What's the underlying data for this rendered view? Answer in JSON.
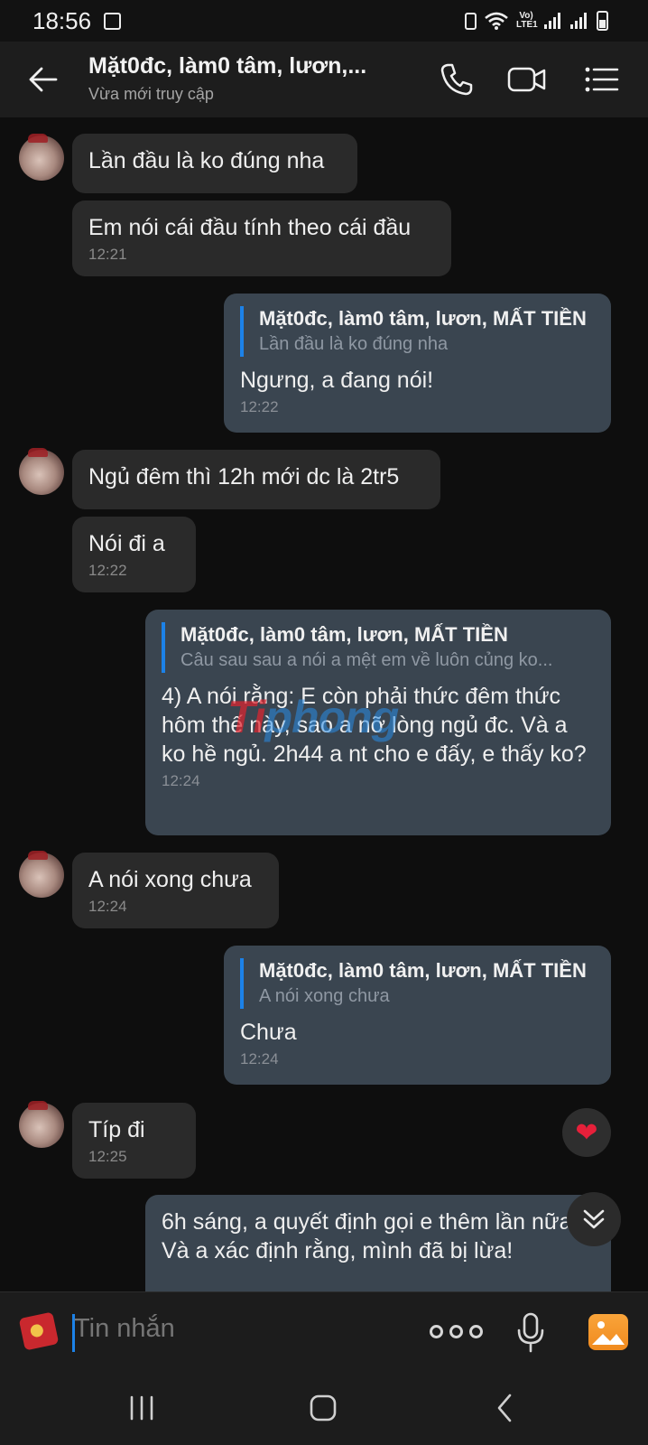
{
  "status_bar": {
    "time": "18:56",
    "network_label": "Vo) LTE1",
    "icons": [
      "image-icon",
      "nfc-icon",
      "wifi-icon",
      "signal-icon",
      "signal-icon",
      "battery-icon"
    ]
  },
  "header": {
    "contact_name": "Mặt0đc, làm0 tâm, lươn,...",
    "last_seen": "Vừa mới truy cập",
    "icons": [
      "back-arrow-icon",
      "phone-icon",
      "video-call-icon",
      "menu-list-icon"
    ]
  },
  "messages": [
    {
      "direction": "in",
      "text": "Lần đầu là ko đúng nha"
    },
    {
      "direction": "in",
      "text": "Em nói cái đầu tính theo cái đầu",
      "time": "12:21"
    },
    {
      "direction": "out",
      "quote_name": "Mặt0đc, làm0 tâm, lươn, MẤT TIỀN",
      "quote_text": "Lần đầu là ko đúng nha",
      "text": "Ngưng, a đang nói!",
      "time": "12:22"
    },
    {
      "direction": "in",
      "text": "Ngủ đêm thì 12h mới dc là 2tr5"
    },
    {
      "direction": "in",
      "text": "Nói đi a",
      "time": "12:22"
    },
    {
      "direction": "out",
      "quote_name": "Mặt0đc, làm0 tâm, lươn, MẤT TIỀN",
      "quote_text": "Câu sau sau a nói a mệt em về luôn củng ko...",
      "text": "4) A nói rằng: E còn phải thức đêm thức hôm thế này, sao a nỡ lòng ngủ đc. Và a ko hề ngủ. 2h44 a nt cho e đấy, e thấy ko?",
      "time": "12:24"
    },
    {
      "direction": "in",
      "text": "A nói xong chưa",
      "time": "12:24"
    },
    {
      "direction": "out",
      "quote_name": "Mặt0đc, làm0 tâm, lươn, MẤT TIỀN",
      "quote_text": "A nói xong chưa",
      "text": "Chưa",
      "time": "12:24"
    },
    {
      "direction": "in",
      "text": "Típ đi",
      "time": "12:25",
      "reaction": "❤"
    },
    {
      "direction": "out",
      "text": "6h sáng, a quyết định gọi e thêm lần nữa. Và a xác định rằng, mình đã bị lừa!"
    }
  ],
  "watermark": {
    "part1": "Ti",
    "part2": "phong"
  },
  "composer": {
    "placeholder": "Tin nhắn",
    "icons": [
      "sticker-icon",
      "more-options-icon",
      "microphone-icon",
      "image-gallery-icon"
    ]
  },
  "navbar": {
    "icons": [
      "recent-apps-icon",
      "home-icon",
      "back-icon"
    ]
  },
  "colors": {
    "accent": "#1c82e8",
    "incoming_bubble": "#2a2a2a",
    "outgoing_bubble": "#3a4550",
    "header": "#1d1d1d",
    "background": "#0e0e0e",
    "reaction": "#e6203a"
  }
}
